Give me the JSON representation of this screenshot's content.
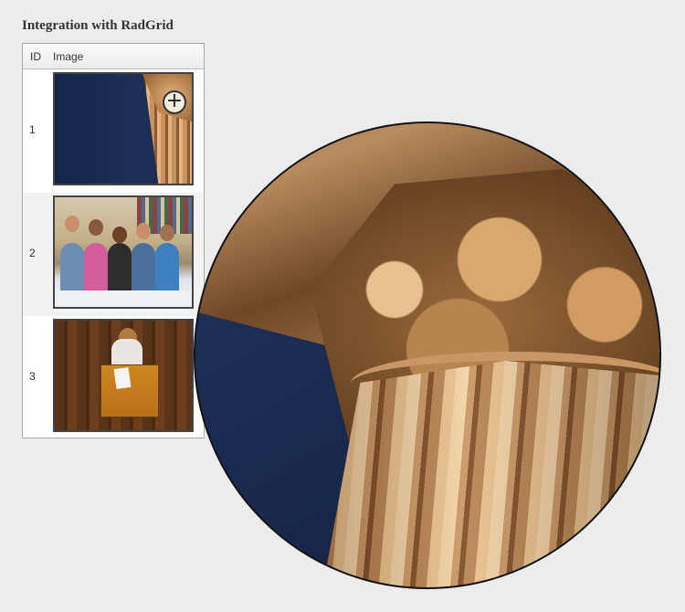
{
  "page": {
    "title": "Integration with RadGrid"
  },
  "grid": {
    "columns": [
      "ID",
      "Image"
    ],
    "rows": [
      {
        "id": "1",
        "image": "column-capital-photo"
      },
      {
        "id": "2",
        "image": "students-group-photo"
      },
      {
        "id": "3",
        "image": "student-at-desk-photo"
      }
    ]
  },
  "zoom": {
    "badge_symbol": "+",
    "magnified_image": "column-capital-photo"
  },
  "colors": {
    "background": "#ececec",
    "grid_border": "#a8a8a8",
    "alt_row": "#f2f2f2",
    "magnifier_border": "#111111"
  }
}
